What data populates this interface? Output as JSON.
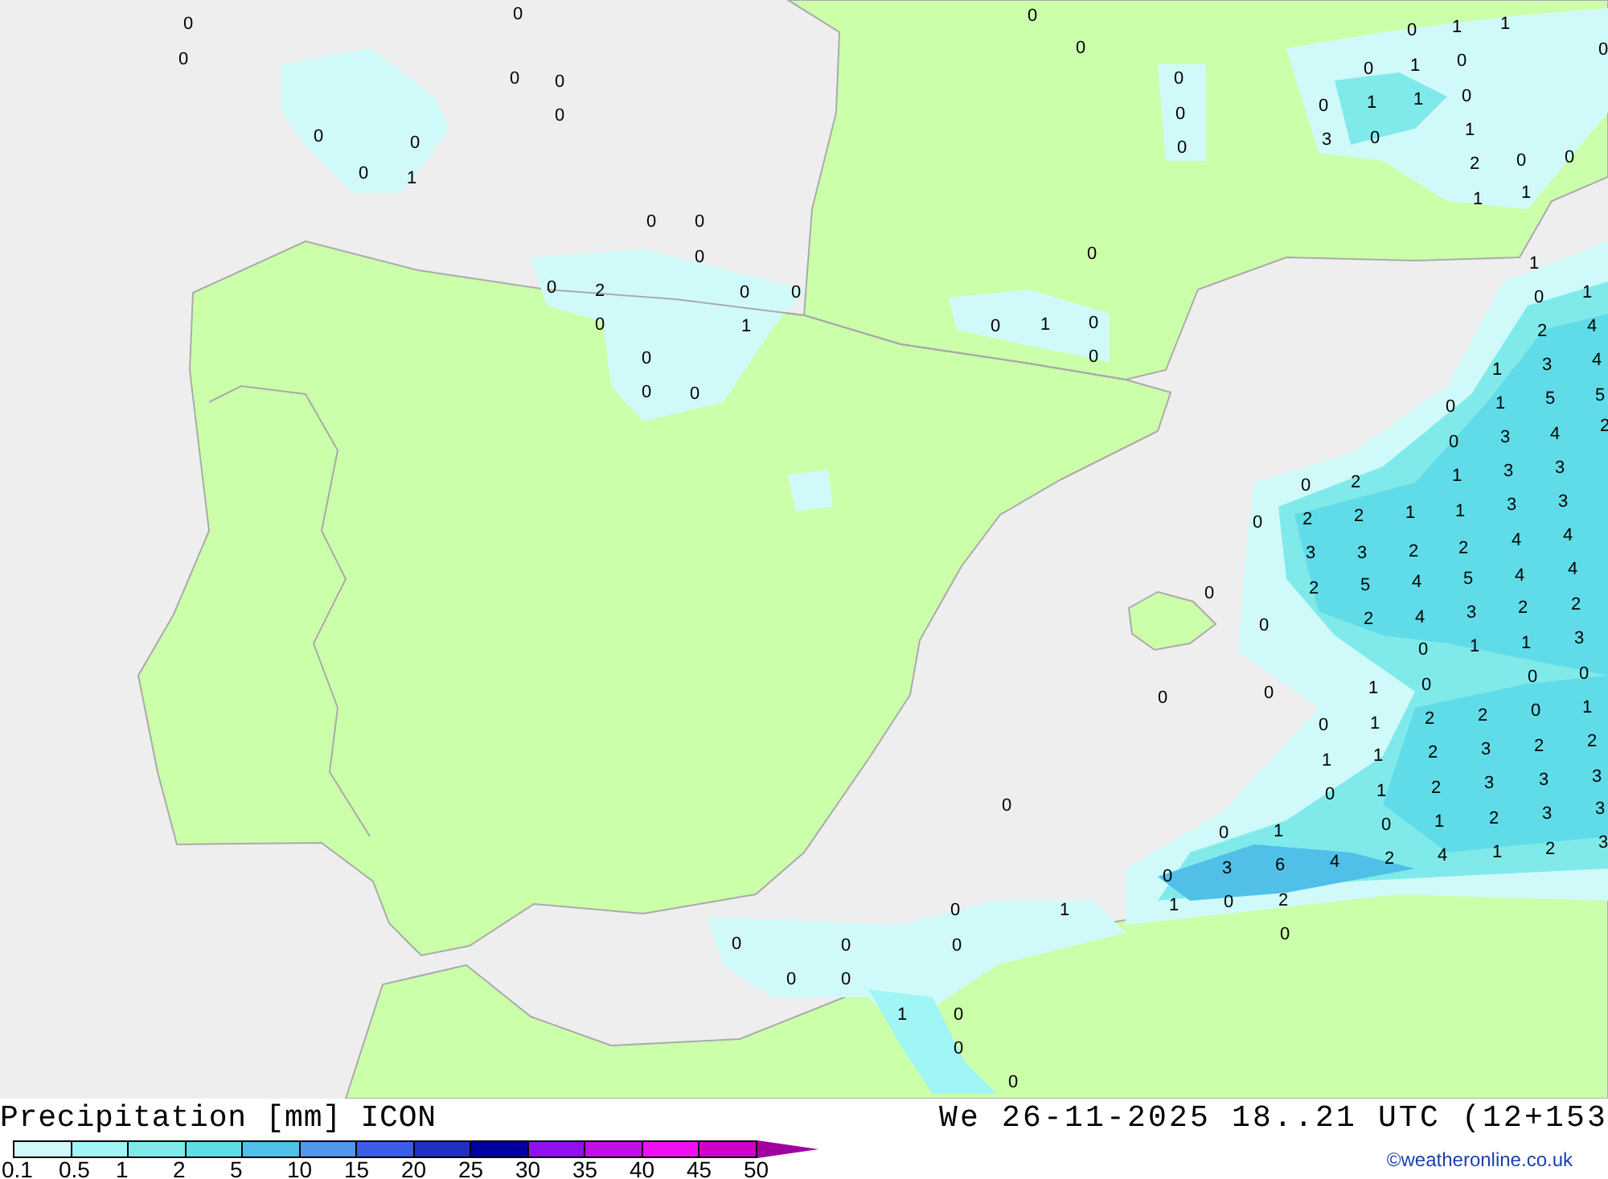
{
  "map": {
    "precipitation_values": [
      "0",
      "0",
      "0",
      "0",
      "0",
      "0",
      "0",
      "0",
      "0",
      "1",
      "0",
      "0",
      "0",
      "0",
      "2",
      "0",
      "0",
      "0",
      "1",
      "0",
      "0",
      "0",
      "0",
      "0",
      "0",
      "0",
      "1",
      "0",
      "0",
      "0",
      "0",
      "0",
      "0",
      "1",
      "1",
      "0",
      "1",
      "0",
      "0",
      "1",
      "1",
      "0",
      "3",
      "0",
      "1",
      "2",
      "0",
      "0",
      "1",
      "1",
      "0",
      "1",
      "0",
      "1",
      "2",
      "4",
      "1",
      "3",
      "4",
      "0",
      "1",
      "5",
      "5",
      "0",
      "3",
      "4",
      "1",
      "3",
      "3",
      "0",
      "2",
      "0",
      "2",
      "2",
      "1",
      "1",
      "3",
      "3",
      "4",
      "4",
      "2",
      "3",
      "3",
      "2",
      "2",
      "0",
      "2",
      "5",
      "4",
      "5",
      "4",
      "4",
      "0",
      "2",
      "4",
      "3",
      "2",
      "2",
      "0",
      "1",
      "1",
      "3",
      "0",
      "0",
      "1",
      "0",
      "0",
      "0",
      "0",
      "1",
      "2",
      "2",
      "0",
      "1",
      "1",
      "1",
      "2",
      "3",
      "2",
      "2",
      "0",
      "1",
      "2",
      "3",
      "3",
      "3",
      "0",
      "1",
      "0",
      "1",
      "2",
      "3",
      "3",
      "0",
      "3",
      "6",
      "4",
      "2",
      "4",
      "1",
      "2",
      "3",
      "1",
      "0",
      "2",
      "0",
      "0",
      "0",
      "1",
      "0",
      "0",
      "0",
      "0",
      "0",
      "1",
      "0",
      "0",
      "0"
    ]
  },
  "footer": {
    "title": "Precipitation [mm] ICON",
    "datetime": "We 26-11-2025 18..21 UTC (12+153",
    "credit": "©weatheronline.co.uk",
    "scale": [
      {
        "label": "0.1",
        "color": "#d0fafa"
      },
      {
        "label": "0.5",
        "color": "#a0f5f5"
      },
      {
        "label": "1",
        "color": "#80eaea"
      },
      {
        "label": "2",
        "color": "#60dbe8"
      },
      {
        "label": "5",
        "color": "#50c0e8"
      },
      {
        "label": "10",
        "color": "#5098e8"
      },
      {
        "label": "15",
        "color": "#3a5ce8"
      },
      {
        "label": "20",
        "color": "#2030c0"
      },
      {
        "label": "25",
        "color": "#0000a0"
      },
      {
        "label": "30",
        "color": "#9010f0"
      },
      {
        "label": "35",
        "color": "#c010e8"
      },
      {
        "label": "40",
        "color": "#f010f0"
      },
      {
        "label": "45",
        "color": "#d000c8"
      },
      {
        "label": "50",
        "color": "#a000a0"
      }
    ]
  }
}
